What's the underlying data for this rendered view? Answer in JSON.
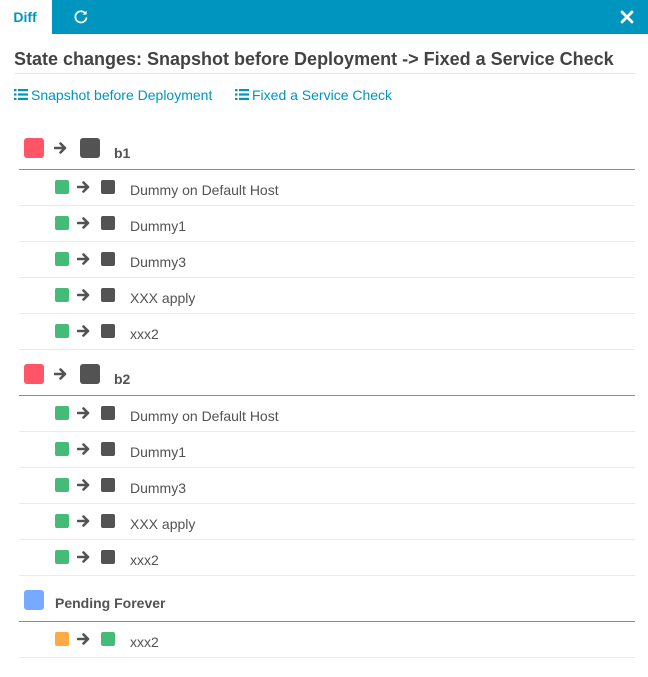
{
  "tabs": {
    "active_label": "Diff"
  },
  "icons": {
    "refresh": "refresh-icon",
    "close": "close-icon",
    "list": "list-icon",
    "arrow": "arrow-right-icon"
  },
  "colors": {
    "brand": "#0095bf",
    "critical": "#ff5566",
    "ok": "#44bb77",
    "unknown": "#535353",
    "pending": "#77aaff",
    "warning": "#ffaa44"
  },
  "page": {
    "title": "State changes: Snapshot before Deployment -> Fixed a Service Check",
    "from_link": "Snapshot before Deployment",
    "to_link": "Fixed a Service Check"
  },
  "groups": [
    {
      "name": "b1",
      "from_state": "critical",
      "to_state": "unknown",
      "items": [
        {
          "name": "Dummy on Default Host",
          "from_state": "ok",
          "to_state": "unknown"
        },
        {
          "name": "Dummy1",
          "from_state": "ok",
          "to_state": "unknown"
        },
        {
          "name": "Dummy3",
          "from_state": "ok",
          "to_state": "unknown"
        },
        {
          "name": "XXX apply",
          "from_state": "ok",
          "to_state": "unknown"
        },
        {
          "name": "xxx2",
          "from_state": "ok",
          "to_state": "unknown"
        }
      ]
    },
    {
      "name": "b2",
      "from_state": "critical",
      "to_state": "unknown",
      "items": [
        {
          "name": "Dummy on Default Host",
          "from_state": "ok",
          "to_state": "unknown"
        },
        {
          "name": "Dummy1",
          "from_state": "ok",
          "to_state": "unknown"
        },
        {
          "name": "Dummy3",
          "from_state": "ok",
          "to_state": "unknown"
        },
        {
          "name": "XXX apply",
          "from_state": "ok",
          "to_state": "unknown"
        },
        {
          "name": "xxx2",
          "from_state": "ok",
          "to_state": "unknown"
        }
      ]
    },
    {
      "name": "Pending Forever",
      "from_state": "pending",
      "to_state": null,
      "items": [
        {
          "name": "xxx2",
          "from_state": "warning",
          "to_state": "ok"
        }
      ]
    }
  ]
}
